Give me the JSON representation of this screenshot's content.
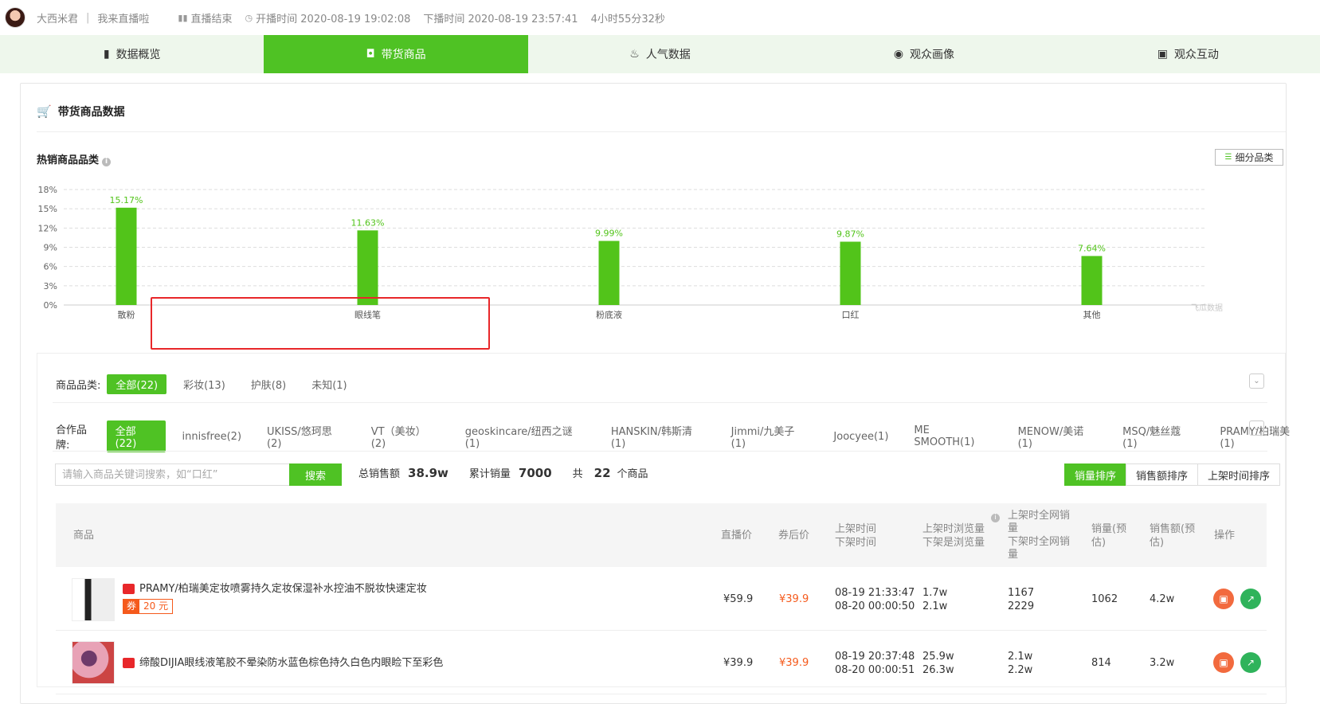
{
  "header": {
    "streamer_name": "大西米君",
    "stream_title": "我来直播啦",
    "status": "直播结束",
    "start_label": "开播时间 2020-08-19 19:02:08",
    "end_label": "下播时间 2020-08-19 23:57:41",
    "duration": "4小时55分32秒"
  },
  "tabs": [
    {
      "label": "数据概览",
      "icon": "bar-chart-icon"
    },
    {
      "label": "带货商品",
      "icon": "shopping-bag-icon",
      "active": true
    },
    {
      "label": "人气数据",
      "icon": "fire-icon"
    },
    {
      "label": "观众画像",
      "icon": "portrait-icon"
    },
    {
      "label": "观众互动",
      "icon": "interaction-icon"
    }
  ],
  "section": {
    "title": "带货商品数据",
    "hot_title": "热销商品品类",
    "subcategory_button": "细分品类"
  },
  "chart_data": {
    "type": "bar",
    "categories": [
      "散粉",
      "眼线笔",
      "粉底液",
      "口红",
      "其他"
    ],
    "values": [
      15.17,
      11.63,
      9.99,
      9.87,
      7.64
    ],
    "value_labels": [
      "15.17%",
      "11.63%",
      "9.99%",
      "9.87%",
      "7.64%"
    ],
    "y_ticks": [
      "0%",
      "3%",
      "6%",
      "9%",
      "12%",
      "15%",
      "18%"
    ],
    "ylim": [
      0,
      18
    ],
    "grid": true,
    "bar_color": "#52c41a",
    "watermark": "飞瓜数据"
  },
  "filters": {
    "category_label": "商品品类:",
    "categories": [
      "全部(22)",
      "彩妆(13)",
      "护肤(8)",
      "未知(1)"
    ],
    "brand_label": "合作品牌:",
    "brands": [
      "全部(22)",
      "innisfree(2)",
      "UKISS/悠珂思(2)",
      "VT（美妆）(2)",
      "geoskincare/纽西之谜(1)",
      "HANSKIN/韩斯清(1)",
      "Jimmi/九美子(1)",
      "Joocyee(1)",
      "ME SMOOTH(1)",
      "MENOW/美诺(1)",
      "MSQ/魅丝蔻(1)",
      "PRAMY/柏瑞美(1)"
    ]
  },
  "search": {
    "placeholder": "请输入商品关键词搜索，如“口红”",
    "button": "搜索",
    "total_sales_label": "总销售额",
    "total_sales": "38.9w",
    "total_qty_label": "累计销量",
    "total_qty": "7000",
    "count_prefix": "共",
    "count": "22",
    "count_suffix": "个商品"
  },
  "sorts": [
    "销量排序",
    "销售额排序",
    "上架时间排序"
  ],
  "table": {
    "headers": {
      "product": "商品",
      "live_price": "直播价",
      "after_coupon": "券后价",
      "time_on": "上架时间",
      "time_off": "下架时间",
      "views_on": "上架时浏览量",
      "views_off": "下架是浏览量",
      "net_on": "上架时全网销",
      "net_on2": "量",
      "net_off": "下架时全网销",
      "net_off2": "量",
      "qty": "销量(预",
      "qty2": "估)",
      "amount": "销售额(预",
      "amount2": "估)",
      "action": "操作"
    },
    "rows": [
      {
        "name": "PRAMY/柏瑞美定妆喷雾持久定妆保湿补水控油不脱妆快速定妆",
        "coupon_tag": "券",
        "coupon_value": "20 元",
        "live_price": "¥59.9",
        "after_price": "¥39.9",
        "time_on": "08-19 21:33:47",
        "time_off": "08-20 00:00:50",
        "views_on": "1.7w",
        "views_off": "2.1w",
        "net_on": "1167",
        "net_off": "2229",
        "qty": "1062",
        "amount": "4.2w"
      },
      {
        "name": "缔酸DIJIA眼线液笔胶不晕染防水蓝色棕色持久白色内眼睑下至彩色",
        "live_price": "¥39.9",
        "after_price": "¥39.9",
        "time_on": "08-19 20:37:48",
        "time_off": "08-20 00:00:51",
        "views_on": "25.9w",
        "views_off": "26.3w",
        "net_on": "2.1w",
        "net_off": "2.2w",
        "qty": "814",
        "amount": "3.2w"
      }
    ]
  }
}
